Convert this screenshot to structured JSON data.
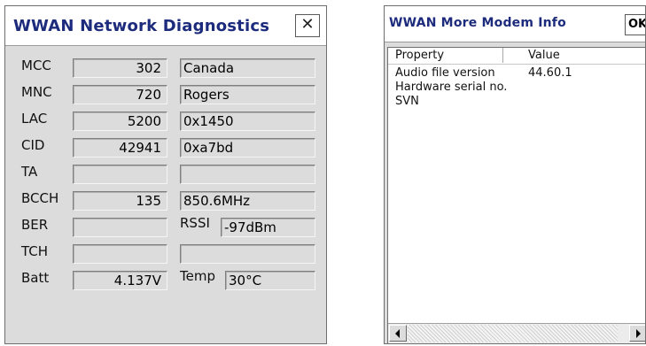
{
  "diagnostics": {
    "title": "WWAN Network Diagnostics",
    "close_glyph": "✕",
    "rows": [
      {
        "label": "MCC",
        "value": "302",
        "info": "Canada"
      },
      {
        "label": "MNC",
        "value": "720",
        "info": "Rogers"
      },
      {
        "label": "LAC",
        "value": "5200",
        "info": "0x1450"
      },
      {
        "label": "CID",
        "value": "42941",
        "info": "0xa7bd"
      },
      {
        "label": "TA",
        "value": "",
        "info": ""
      },
      {
        "label": "BCCH",
        "value": "135",
        "info": "850.6MHz"
      },
      {
        "label": "BER",
        "value": "",
        "info_label": "RSSI",
        "info": "-97dBm"
      },
      {
        "label": "TCH",
        "value": "",
        "info": ""
      },
      {
        "label": "Batt",
        "value": "4.137V",
        "info_label": "Temp",
        "info": "30°C"
      }
    ]
  },
  "modem_info": {
    "title": "WWAN More Modem Info",
    "ok_label": "OK",
    "columns": [
      "Property",
      "Value"
    ],
    "rows": [
      {
        "property": "Audio file version",
        "value": "44.60.1"
      },
      {
        "property": "Hardware serial no.",
        "value": ""
      },
      {
        "property": "SVN",
        "value": ""
      }
    ],
    "scrollbar": {
      "left_icon": "left-arrow-icon",
      "right_icon": "right-arrow-icon"
    }
  }
}
